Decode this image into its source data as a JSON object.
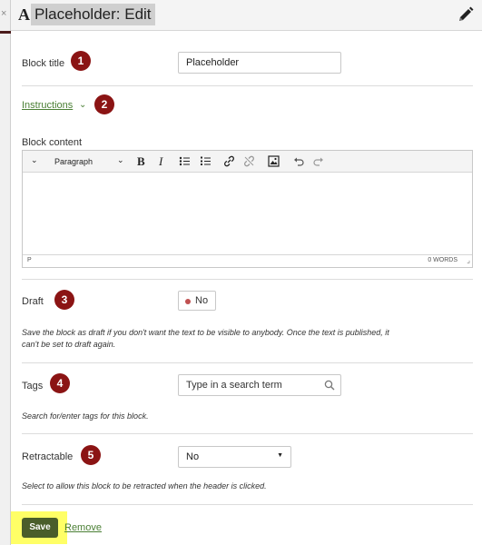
{
  "window": {
    "close_glyph": "×"
  },
  "header": {
    "type_icon": "A",
    "title": "Placeholder: Edit",
    "edit_icon": "pencil-icon"
  },
  "block_title": {
    "label": "Block title",
    "value": "Placeholder",
    "marker": "1"
  },
  "instructions": {
    "label": "Instructions",
    "marker": "2"
  },
  "block_content": {
    "label": "Block content",
    "toolbar": {
      "paragraph": "Paragraph",
      "bold": "B",
      "italic": "I"
    },
    "status_path": "P",
    "word_count": "0 WORDS"
  },
  "draft": {
    "label": "Draft",
    "value": "No",
    "marker": "3",
    "hint_line1": "Save the block as draft if you don't want the text to be visible to anybody. Once the text is published, it",
    "hint_line2": "can't be set to draft again."
  },
  "tags": {
    "label": "Tags",
    "placeholder": "Type in a search term",
    "marker": "4",
    "hint": "Search for/enter tags for this block."
  },
  "retractable": {
    "label": "Retractable",
    "value": "No",
    "marker": "5",
    "hint": "Select to allow this block to be retracted when the header is clicked."
  },
  "actions": {
    "save": "Save",
    "remove": "Remove"
  },
  "colors": {
    "accent_green": "#4a7f34",
    "marker_red": "#8b1414",
    "save_bg": "#4a5d2a",
    "highlight": "#ffff66"
  }
}
